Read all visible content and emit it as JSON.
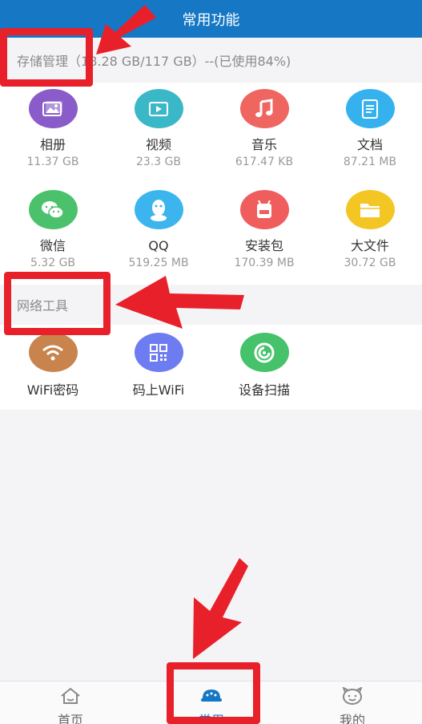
{
  "header": {
    "title": "常用功能"
  },
  "storage": {
    "title": "存储管理",
    "summary": "（18.28 GB/117 GB）--(已使用84%)",
    "items": [
      {
        "label": "相册",
        "size": "11.37 GB",
        "icon": "photo-album-icon",
        "color": "#8a5cc9"
      },
      {
        "label": "视频",
        "size": "23.3 GB",
        "icon": "video-icon",
        "color": "#3bb8c8"
      },
      {
        "label": "音乐",
        "size": "617.47 KB",
        "icon": "music-icon",
        "color": "#ef6560"
      },
      {
        "label": "文档",
        "size": "87.21 MB",
        "icon": "document-icon",
        "color": "#35b2ee"
      },
      {
        "label": "微信",
        "size": "5.32 GB",
        "icon": "wechat-icon",
        "color": "#4cc16c"
      },
      {
        "label": "QQ",
        "size": "519.25 MB",
        "icon": "qq-icon",
        "color": "#3cb5ee"
      },
      {
        "label": "安装包",
        "size": "170.39 MB",
        "icon": "apk-icon",
        "color": "#ef5d5d"
      },
      {
        "label": "大文件",
        "size": "30.72 GB",
        "icon": "folder-icon",
        "color": "#f3c624"
      }
    ]
  },
  "network": {
    "title": "网络工具",
    "items": [
      {
        "label": "WiFi密码",
        "icon": "wifi-icon",
        "color": "#c9844d"
      },
      {
        "label": "码上WiFi",
        "icon": "qr-code-icon",
        "color": "#6d7cf0"
      },
      {
        "label": "设备扫描",
        "icon": "device-scan-icon",
        "color": "#45c26a"
      }
    ]
  },
  "tabbar": {
    "items": [
      {
        "label": "首页",
        "icon": "home-icon"
      },
      {
        "label": "常用",
        "icon": "common-tools-icon",
        "active": true
      },
      {
        "label": "我的",
        "icon": "profile-face-icon"
      }
    ]
  },
  "annotations": {
    "color": "#e8202a"
  }
}
